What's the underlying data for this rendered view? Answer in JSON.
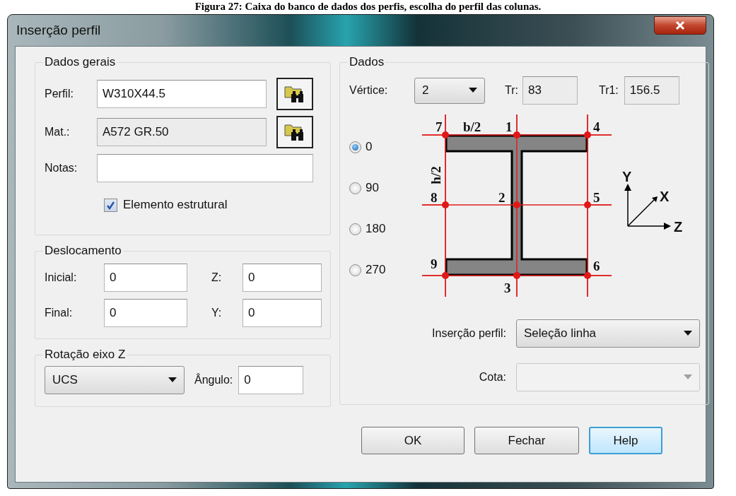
{
  "caption": "Figura 27: Caixa do banco de dados dos perfis, escolha do perfil das colunas.",
  "window": {
    "title": "Inserção perfil"
  },
  "general": {
    "title": "Dados gerais",
    "fields": [
      {
        "label": "Perfil:",
        "value": "W310X44.5",
        "readonly": false,
        "kind": "browse"
      },
      {
        "label": "Mat.:",
        "value": "A572 GR.50",
        "readonly": true,
        "kind": "browse"
      },
      {
        "label": "Notas:",
        "readonly": false,
        "kind": "plain"
      }
    ],
    "checkbox": {
      "label": "Elemento estrutural",
      "checked": true
    }
  },
  "offset": {
    "title": "Deslocamento",
    "fields": [
      {
        "label": "Inicial:",
        "value": "0"
      },
      {
        "label": "Z:",
        "value": "0"
      },
      {
        "label": "Final:",
        "value": "0"
      },
      {
        "label": "Y:",
        "value": "0"
      }
    ]
  },
  "rotation": {
    "title": "Rotação eixo Z",
    "combo": {
      "value": "UCS"
    },
    "angle": {
      "label": "Ângulo:",
      "value": "0"
    }
  },
  "data": {
    "title": "Dados",
    "vertex": {
      "label": "Vértice:",
      "value": "2"
    },
    "tr": {
      "label": "Tr:",
      "value": "83"
    },
    "tr1": {
      "label": "Tr1:",
      "value": "156.5"
    },
    "angles": [
      {
        "label": "0",
        "selected": true
      },
      {
        "label": "90",
        "selected": false
      },
      {
        "label": "180",
        "selected": false
      },
      {
        "label": "270",
        "selected": false
      }
    ],
    "diagram_labels": [
      "7",
      "b/2",
      "1",
      "4",
      "h/2",
      "8",
      "2",
      "5",
      "9",
      "6",
      "3"
    ],
    "axes": [
      "Y",
      "X",
      "Z"
    ],
    "insertion": {
      "label": "Inserção perfil:",
      "value": "Seleção linha"
    },
    "cota": {
      "label": "Cota:",
      "disabled": true
    }
  },
  "buttons": [
    {
      "label": "OK",
      "focused": false
    },
    {
      "label": "Fechar",
      "focused": false
    },
    {
      "label": "Help",
      "focused": true
    }
  ]
}
